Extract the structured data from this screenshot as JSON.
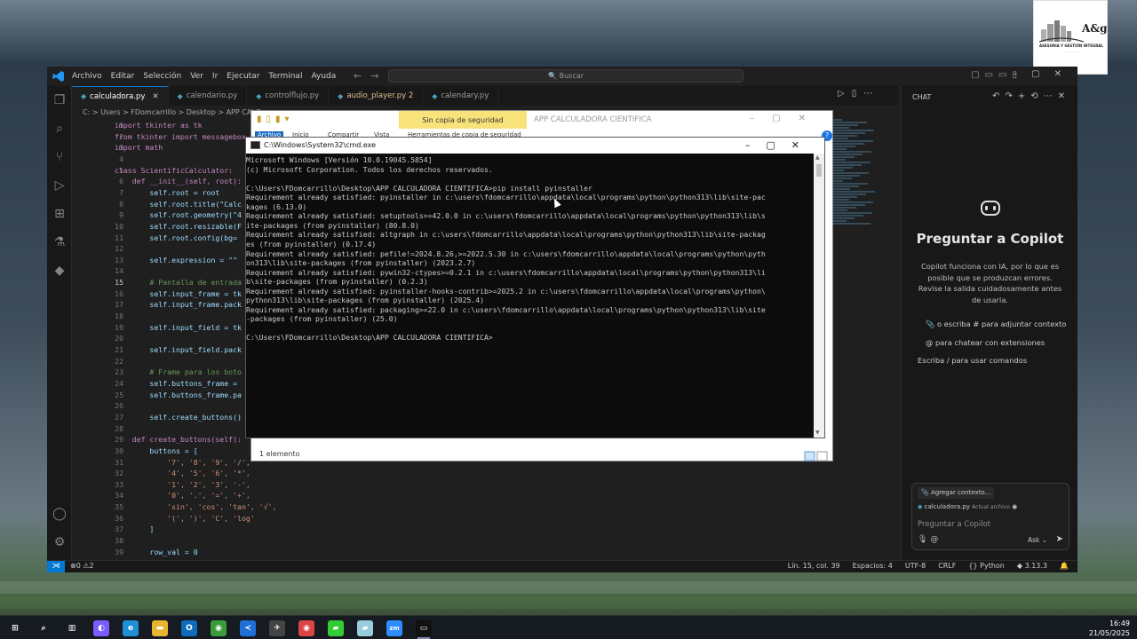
{
  "vscode": {
    "menu": [
      "Archivo",
      "Editar",
      "Selección",
      "Ver",
      "Ir",
      "Ejecutar",
      "Terminal",
      "Ayuda"
    ],
    "search_label": "Buscar",
    "tabs": [
      {
        "label": "calculadora.py",
        "active": true
      },
      {
        "label": "calendario.py"
      },
      {
        "label": "controlflujo.py"
      },
      {
        "label": "audio_player.py 2",
        "modified": true
      },
      {
        "label": "calendary.py"
      }
    ],
    "breadcrumb": "C: > Users > FDomcarrillo > Desktop > APP CALC",
    "line_numbers": [
      "1",
      "2",
      "3",
      "4",
      "5",
      "6",
      "7",
      "8",
      "9",
      "10",
      "11",
      "12",
      "13",
      "14",
      "15",
      "16",
      "17",
      "18",
      "19",
      "20",
      "21",
      "22",
      "23",
      "24",
      "25",
      "26",
      "27",
      "28",
      "29",
      "30",
      "31",
      "32",
      "33",
      "34",
      "35",
      "36",
      "37",
      "38",
      "39"
    ],
    "code_lines": [
      "import tkinter as tk",
      "from tkinter import messagebox",
      "import math",
      "",
      "class ScientificCalculator:",
      "    def __init__(self, root):",
      "        self.root = root",
      "        self.root.title(\"Calc",
      "        self.root.geometry(\"4",
      "        self.root.resizable(F",
      "        self.root.config(bg=",
      "",
      "        self.expression = \"\"",
      "",
      "        # Pantalla de entrada",
      "        self.input_frame = tk",
      "        self.input_frame.pack",
      "",
      "        self.input_field = tk",
      "",
      "        self.input_field.pack",
      "",
      "        # Frame para los boto",
      "        self.buttons_frame =",
      "        self.buttons_frame.pa",
      "",
      "        self.create_buttons()",
      "",
      "    def create_buttons(self):",
      "        buttons = [",
      "            '7', '8', '9', '/',",
      "            '4', '5', '6', '*',",
      "            '1', '2', '3', '-',",
      "            '0', '.', '=', '+',",
      "            'sin', 'cos', 'tan', '√',",
      "            '(', ')', 'C', 'log'",
      "        ]",
      "",
      "        row_val = 0"
    ],
    "chat": {
      "header": "CHAT",
      "title": "Preguntar a Copilot",
      "description": "Copilot funciona con IA, por lo que es posible que se produzcan errores. Revise la salida cuidadosamente antes de usarla.",
      "hints": [
        "o escriba # para adjuntar contexto",
        "para chatear con extensiones",
        "Escriba / para usar comandos"
      ],
      "add_context": "Agregar contexto...",
      "file_chip": "calculadora.py",
      "file_chip_note": "Actual archivo",
      "placeholder": "Preguntar a Copilot",
      "mode": "Ask"
    },
    "status": {
      "errors": "0",
      "warnings": "2",
      "position": "Lín. 15, col. 39",
      "spaces": "Espacios: 4",
      "encoding": "UTF-8",
      "eol": "CRLF",
      "language": "Python",
      "version": "3.13.3"
    }
  },
  "explorer": {
    "backup_tab": "Sin copia de seguridad",
    "app_title": "APP CALCULADORA CIENTIFICA",
    "ribbon": [
      "Archivo",
      "Inicio",
      "Compartir",
      "Vista",
      "Herramientas de copia de seguridad"
    ],
    "status_text": "1 elemento"
  },
  "cmd": {
    "title": "C:\\Windows\\System32\\cmd.exe",
    "lines": [
      "Microsoft Windows [Versión 10.0.19045.5854]",
      "(c) Microsoft Corporation. Todos los derechos reservados.",
      "",
      "C:\\Users\\FDomcarrillo\\Desktop\\APP CALCULADORA CIENTIFICA>pip install pyinstaller",
      "Requirement already satisfied: pyinstaller in c:\\users\\fdomcarrillo\\appdata\\local\\programs\\python\\python313\\lib\\site-pac",
      "kages (6.13.0)",
      "Requirement already satisfied: setuptools>=42.0.0 in c:\\users\\fdomcarrillo\\appdata\\local\\programs\\python\\python313\\lib\\s",
      "ite-packages (from pyinstaller) (80.8.0)",
      "Requirement already satisfied: altgraph in c:\\users\\fdomcarrillo\\appdata\\local\\programs\\python\\python313\\lib\\site-packag",
      "es (from pyinstaller) (0.17.4)",
      "Requirement already satisfied: pefile!=2024.8.26,>=2022.5.30 in c:\\users\\fdomcarrillo\\appdata\\local\\programs\\python\\pyth",
      "on313\\lib\\site-packages (from pyinstaller) (2023.2.7)",
      "Requirement already satisfied: pywin32-ctypes>=0.2.1 in c:\\users\\fdomcarrillo\\appdata\\local\\programs\\python\\python313\\li",
      "b\\site-packages (from pyinstaller) (0.2.3)",
      "Requirement already satisfied: pyinstaller-hooks-contrib>=2025.2 in c:\\users\\fdomcarrillo\\appdata\\local\\programs\\python\\",
      "python313\\lib\\site-packages (from pyinstaller) (2025.4)",
      "Requirement already satisfied: packaging>=22.0 in c:\\users\\fdomcarrillo\\appdata\\local\\programs\\python\\python313\\lib\\site",
      "-packages (from pyinstaller) (25.0)",
      "",
      "C:\\Users\\FDomcarrillo\\Desktop\\APP CALCULADORA CIENTIFICA>"
    ]
  },
  "logo": {
    "mark": "A&g",
    "caption": "ASESORIA Y GESTIÓN INTEGRAL"
  },
  "taskbar": {
    "apps": [
      "start",
      "search",
      "task-view",
      "copilot",
      "edge",
      "file-explorer",
      "outlook",
      "chrome",
      "vscode",
      "app",
      "chrome-profile",
      "app2",
      "app3",
      "zoom",
      "cmd"
    ],
    "zoom_label": "zm",
    "time": "16:49",
    "date": "21/05/2025"
  },
  "colors": {
    "accent": "#0078d4",
    "keyword": "#c586c0",
    "function": "#dcdcaa",
    "string": "#ce9178",
    "comment": "#6a9955"
  }
}
